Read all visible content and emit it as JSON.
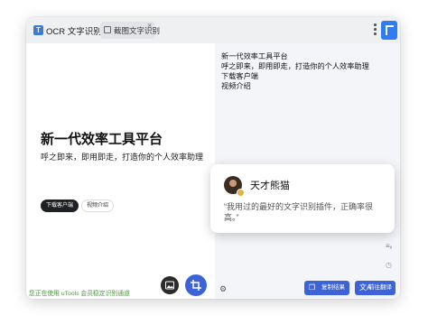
{
  "app": {
    "title": "OCR 文字识别",
    "icon_label": "T"
  },
  "tab": {
    "label": "截图文字识别",
    "close": "×"
  },
  "hero": {
    "title": "新一代效率工具平台",
    "subtitle": "呼之即来，即用即走，打造你的个人效率助理",
    "download_button": "下载客户端",
    "video_button": "视频介绍"
  },
  "status_text": "您正在使用 uTools 会员稳定识别通道",
  "ocr_result": [
    "新一代效率工具平台",
    "呼之即来，即用即走，打造你的个人效率助理",
    "下载客户端",
    "视频介绍"
  ],
  "testimonial": {
    "name": "天才熊猫",
    "quote": "“我用过的最好的文字识别插件，正确率很高。”"
  },
  "actions": {
    "copy": "复制结果",
    "translate": "前往翻译"
  },
  "icons": {
    "settings": "⚙",
    "clear": "≡ₓ",
    "history": "◷",
    "copy": "❐",
    "translate": "文A"
  },
  "colors": {
    "accent": "#3d63d8",
    "status": "#4a9a3c"
  }
}
